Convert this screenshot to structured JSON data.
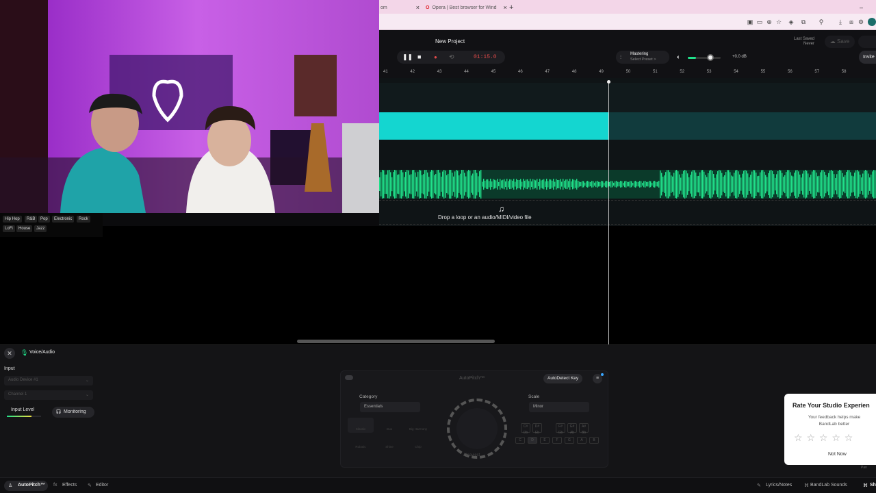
{
  "browser": {
    "tabs": [
      {
        "label": "om",
        "close": "×"
      },
      {
        "label": "Opera | Best browser for Wind",
        "close": "×"
      }
    ],
    "new_tab": "+",
    "minimize": "–",
    "close_window": "×"
  },
  "app": {
    "project_title": "New Project",
    "timer": "01:15.0",
    "mastering": {
      "label": "Mastering",
      "preset": "Select Preset >"
    },
    "volume_db": "+0.0 dB",
    "last_saved_label": "Last Saved",
    "last_saved_value": "Never",
    "save_label": "Save",
    "invite_label": "Invite",
    "ruler_ticks": [
      "41",
      "42",
      "43",
      "44",
      "45",
      "46",
      "47",
      "48",
      "49",
      "50",
      "51",
      "52",
      "53",
      "54",
      "55",
      "56",
      "57",
      "58"
    ],
    "drop_text": "Drop a loop or an audio/MIDI/video file"
  },
  "genres": [
    "Hip Hop",
    "R&B",
    "Pop",
    "Electronic",
    "Rock",
    "LoFi",
    "House",
    "Jazz"
  ],
  "panel": {
    "track_name": "Voice/Audio",
    "input_heading": "Input",
    "device": "Audio Device #1",
    "channel": "Channel 1",
    "input_level": "Input Level",
    "monitoring": "Monitoring"
  },
  "autopitch": {
    "title": "AutoPitch™",
    "autodetect": "AutoDetect Key",
    "category_label": "Category",
    "category_value": "Essentials",
    "scale_label": "Scale",
    "scale_value": "Minor",
    "presets": [
      "Classic",
      "Duo",
      "Big Harmony",
      "Robotic",
      "Shine",
      "Chip"
    ],
    "knob_label": "Heaviest",
    "sharps": [
      "C#\nDb",
      "D#\nEb",
      "F#\nGb",
      "G#\nAb",
      "A#\nBb"
    ],
    "keys": [
      "C",
      "D",
      "E",
      "F",
      "G",
      "A",
      "B"
    ]
  },
  "rate": {
    "title": "Rate Your Studio Experien",
    "subtitle": "Your feedback helps make BandLab better",
    "stars": "☆ ☆ ☆ ☆ ☆",
    "not_now": "Not Now"
  },
  "footer": {
    "autopitch": "AutoPitch™",
    "effects": "Effects",
    "editor": "Editor",
    "lyrics": "Lyrics/Notes",
    "sounds": "BandLab Sounds",
    "shortcut": "Sh",
    "pan": "Pan"
  },
  "colors": {
    "accent": "#14d6d0",
    "waveform": "#20e08a",
    "record": "#e04a4a"
  }
}
